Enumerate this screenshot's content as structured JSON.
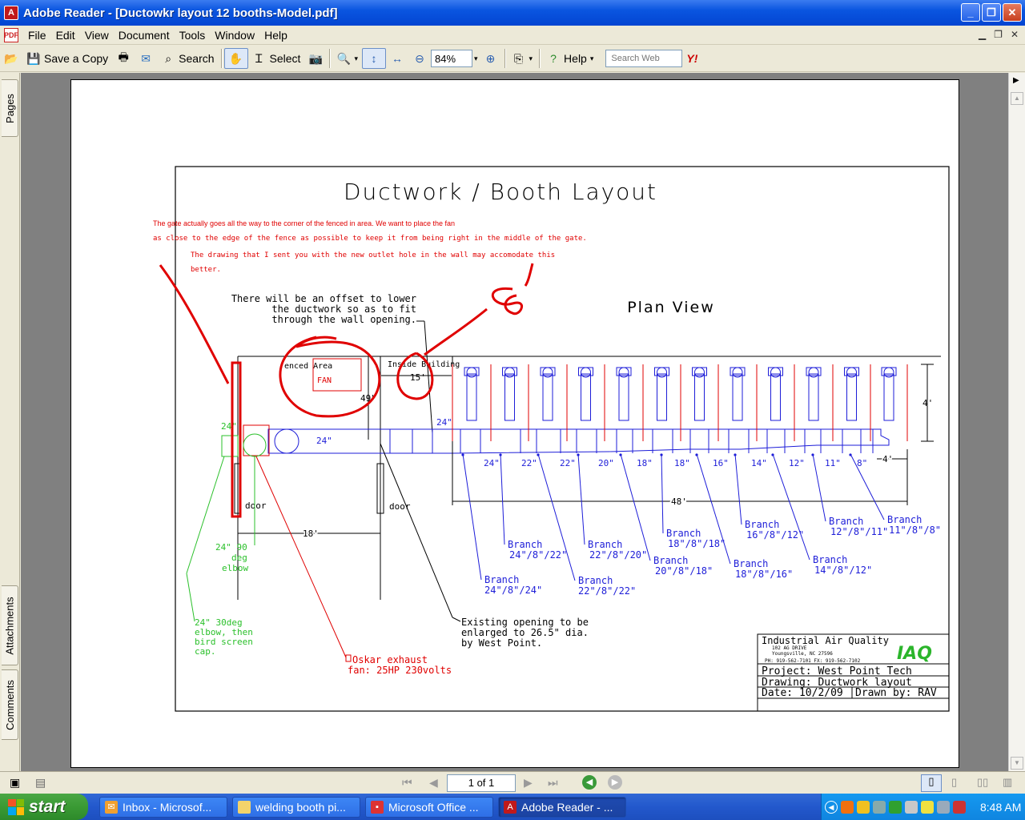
{
  "window": {
    "title": "Adobe Reader - [Ductowkr layout 12 booths-Model.pdf]",
    "min": "_",
    "max": "❐",
    "close": "✕"
  },
  "menu": [
    "File",
    "Edit",
    "View",
    "Document",
    "Tools",
    "Window",
    "Help"
  ],
  "toolbar": {
    "save_copy": "Save a Copy",
    "search": "Search",
    "select": "Select",
    "zoom": "84%",
    "help": "Help",
    "search_web_placeholder": "Search Web",
    "yahoo": "Y!"
  },
  "side_tabs": {
    "pages": "Pages",
    "attachments": "Attachments",
    "comments": "Comments"
  },
  "drawing": {
    "title": "Ductwork / Booth Layout",
    "plan_view": "Plan View",
    "notes": [
      "The gate actually goes all the way to the corner of the fenced in area.  We want to place the fan",
      "as close to the edge of the fence as possible to keep it from being right in the middle of the gate.",
      "The drawing that I sent you with the new outlet hole in the wall may accomodate this",
      "better."
    ],
    "offset_note": [
      "There will be an offset to lower",
      "the ductwork so as to fit",
      "through the wall opening."
    ],
    "fenced_area": "enced Area",
    "fan": "FAN",
    "inside_building": "Inside Building",
    "dim_15": "15'",
    "dim_49": "49\"",
    "dim_24a": "24\"",
    "dim_24b": "24\"",
    "dim_24c": "24\"",
    "dim_4a": "4'",
    "dim_4b": "4'",
    "dim_48": "48'",
    "dim_18": "18'",
    "duct_sizes": [
      "24\"",
      "22\"",
      "22\"",
      "20\"",
      "18\"",
      "18\"",
      "16\"",
      "14\"",
      "12\"",
      "11\"",
      "8\""
    ],
    "door1": "door",
    "door2": "door",
    "elbow90": [
      "24\" 90",
      "deg",
      "elbow"
    ],
    "elbow30": [
      "24\" 30deg",
      "elbow, then",
      "bird screen",
      "cap."
    ],
    "oskar": [
      "Oskar exhaust",
      "fan: 25HP 230volts"
    ],
    "existing_opening": [
      "Existing opening to be",
      "enlarged to 26.5\" dia.",
      "by West Point."
    ],
    "branches": [
      {
        "label": "Branch",
        "size": "24\"/8\"/24\""
      },
      {
        "label": "Branch",
        "size": "24\"/8\"/22\""
      },
      {
        "label": "Branch",
        "size": "22\"/8\"/22\""
      },
      {
        "label": "Branch",
        "size": "22\"/8\"/20\""
      },
      {
        "label": "Branch",
        "size": "20\"/8\"/18\""
      },
      {
        "label": "Branch",
        "size": "18\"/8\"/18\""
      },
      {
        "label": "Branch",
        "size": "18\"/8\"/16\""
      },
      {
        "label": "Branch",
        "size": "16\"/8\"/12\""
      },
      {
        "label": "Branch",
        "size": "14\"/8\"/12\""
      },
      {
        "label": "Branch",
        "size": "12\"/8\"/11\""
      },
      {
        "label": "Branch",
        "size": "11\"/8\"/8\""
      }
    ],
    "annotation_8": "8'",
    "title_block": {
      "company": "Industrial Air Quality",
      "addr1": "102 AG DRIVE",
      "addr2": "Youngsville, NC    27596",
      "phone": "PH: 919-562-7101   FX: 919-562-7102",
      "logo": "IAQ",
      "project": "Project: West Point Tech",
      "drawing": "Drawing: Ductwork layout",
      "date": "Date: 10/2/09",
      "drawn": "Drawn by: RAV"
    }
  },
  "status": {
    "page": "1 of 1"
  },
  "taskbar": {
    "start": "start",
    "tasks": [
      "Inbox - Microsof...",
      "welding booth pi...",
      "Microsoft Office ...",
      "Adobe Reader - ..."
    ],
    "clock": "8:48 AM"
  }
}
